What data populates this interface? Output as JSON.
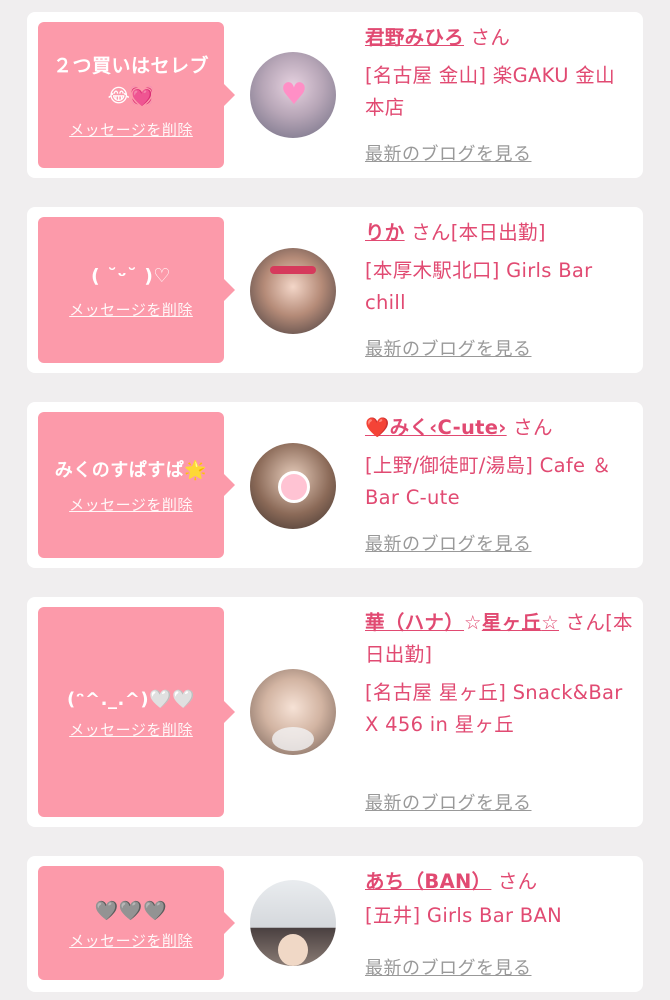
{
  "colors": {
    "accent": "#e14a72",
    "bubble": "#fc9aaa",
    "muted": "#999999",
    "card": "#ffffff",
    "background": "#f0eeef"
  },
  "common": {
    "delete_label": "メッセージを削除",
    "blog_label": "最新のブログを見る"
  },
  "cards": [
    {
      "message": "２つ買いはセレブ",
      "message2": "😂💓",
      "name": "君野みひろ",
      "suffix": " さん",
      "shop": "[名古屋 金山] 楽GAKU 金山本店"
    },
    {
      "message": "( ˘ᵕ˘ )♡",
      "name": "りか",
      "suffix": " さん[本日出勤]",
      "shop": "[本厚木駅北口] Girls Bar chill"
    },
    {
      "message": "みくのすぱすぱ🌟",
      "name_prefix": "❤️",
      "name": "みく‹C-ute›",
      "suffix": " さん",
      "shop": "[上野/御徒町/湯島] Cafe ＆Bar C-ute"
    },
    {
      "message": "(ᵔ^._.^)🤍🤍",
      "name": "華（ハナ）",
      "name_mid": "☆",
      "name2": "星ヶ丘",
      "name_end": "☆",
      "suffix": " さん[本日出勤]",
      "shop": "[名古屋 星ヶ丘] Snack&Bar X 456 in 星ヶ丘"
    },
    {
      "message": "🩶🩶🩶",
      "name": "あち（BAN）",
      "suffix": " さん",
      "shop": "[五井] Girls Bar BAN"
    }
  ]
}
